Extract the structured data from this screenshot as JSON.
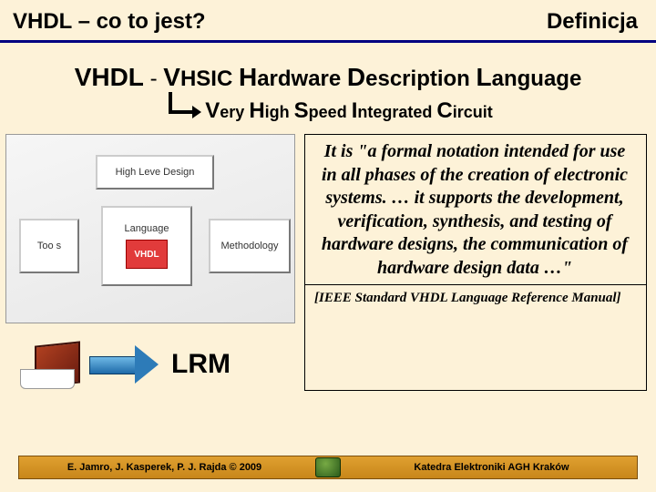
{
  "header": {
    "left": "VHDL – co to jest?",
    "right": "Definicja"
  },
  "acronym": {
    "lead_big": "VHDL",
    "joiner": " - ",
    "V_big": "V",
    "V_rest": "HSIC ",
    "H_big": "H",
    "H_rest": "ardware ",
    "D_big": "D",
    "D_rest": "escription ",
    "L_big": "L",
    "L_rest": "anguage"
  },
  "subline": {
    "V_big": "V",
    "V_rest": "ery ",
    "H_big": "H",
    "H_rest": "igh ",
    "S_big": "S",
    "S_rest": "peed ",
    "I_big": "I",
    "I_rest": "ntegrated ",
    "C_big": "C",
    "C_rest": "ircuit"
  },
  "diagram": {
    "hld": "High Leve Design",
    "tools": "Too s",
    "lang": "Language",
    "vhdl_chip": "VHDL",
    "meth": "Methodology"
  },
  "lrm_label": "LRM",
  "quote": "It is \"a formal notation intended for use in all phases of the creation of electronic systems.  … it supports the development, verification, synthesis, and testing of hardware designs,  the communication of hardware design data …\"",
  "citation": "[IEEE Standard VHDL Language Reference Manual]",
  "footer": {
    "left": "E. Jamro, J. Kasperek, P. J. Rajda © 2009",
    "right": "Katedra Elektroniki AGH Kraków"
  }
}
